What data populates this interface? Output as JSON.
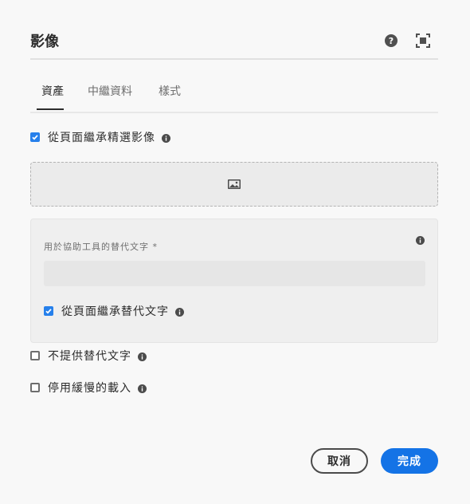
{
  "dialog": {
    "title": "影像"
  },
  "header_icons": {
    "help": "help-circle-icon",
    "fullscreen": "fullscreen-icon"
  },
  "tabs": [
    {
      "label": "資產",
      "active": true
    },
    {
      "label": "中繼資料",
      "active": false
    },
    {
      "label": "樣式",
      "active": false
    }
  ],
  "inherit_featured": {
    "label": "從頁面繼承精選影像",
    "checked": true
  },
  "dropzone": {
    "icon": "image-icon"
  },
  "alt_panel": {
    "label": "用於協助工具的替代文字 *",
    "input_value": "",
    "inherit_alt": {
      "label": "從頁面繼承替代文字",
      "checked": true
    }
  },
  "no_alt": {
    "label": "不提供替代文字",
    "checked": false
  },
  "lazy_disable": {
    "label": "停用緩慢的載入",
    "checked": false
  },
  "buttons": {
    "cancel": "取消",
    "done": "完成"
  },
  "colors": {
    "accent": "#1473e6",
    "checkbox": "#2680eb"
  }
}
